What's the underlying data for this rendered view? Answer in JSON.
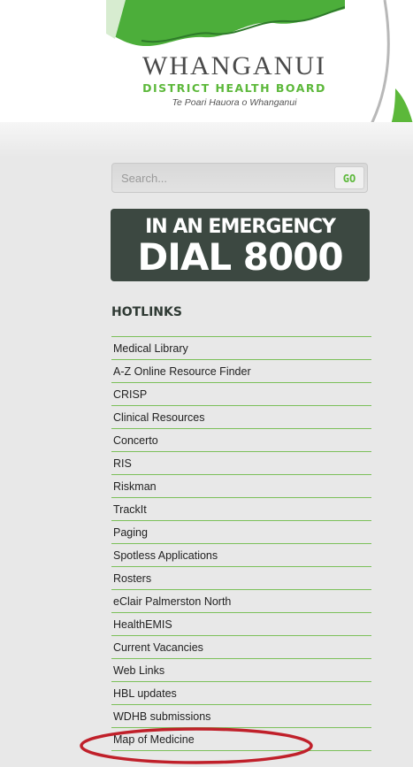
{
  "header": {
    "logo_title": "WHANGANUI",
    "logo_subtitle": "DISTRICT HEALTH BOARD",
    "logo_maori": "Te Poari Hauora o Whanganui"
  },
  "search": {
    "placeholder": "Search...",
    "go_label": "GO"
  },
  "emergency": {
    "line1": "IN AN EMERGENCY",
    "line2": "DIAL 8000"
  },
  "hotlinks": {
    "heading": "HOTLINKS",
    "items": [
      "Medical Library",
      "A-Z Online Resource Finder",
      "CRISP",
      "Clinical Resources",
      "Concerto",
      "RIS",
      "Riskman",
      "TrackIt",
      "Paging",
      "Spotless Applications",
      "Rosters",
      "eClair Palmerston North",
      "HealthEMIS",
      "Current Vacancies",
      "Web Links",
      "HBL updates",
      "WDHB submissions",
      "Map of Medicine"
    ],
    "highlighted_item": "Map of Medicine"
  },
  "colors": {
    "brand_green": "#5cb83a",
    "emergency_bg": "#3c4841",
    "highlight_ring": "#c0202a"
  }
}
